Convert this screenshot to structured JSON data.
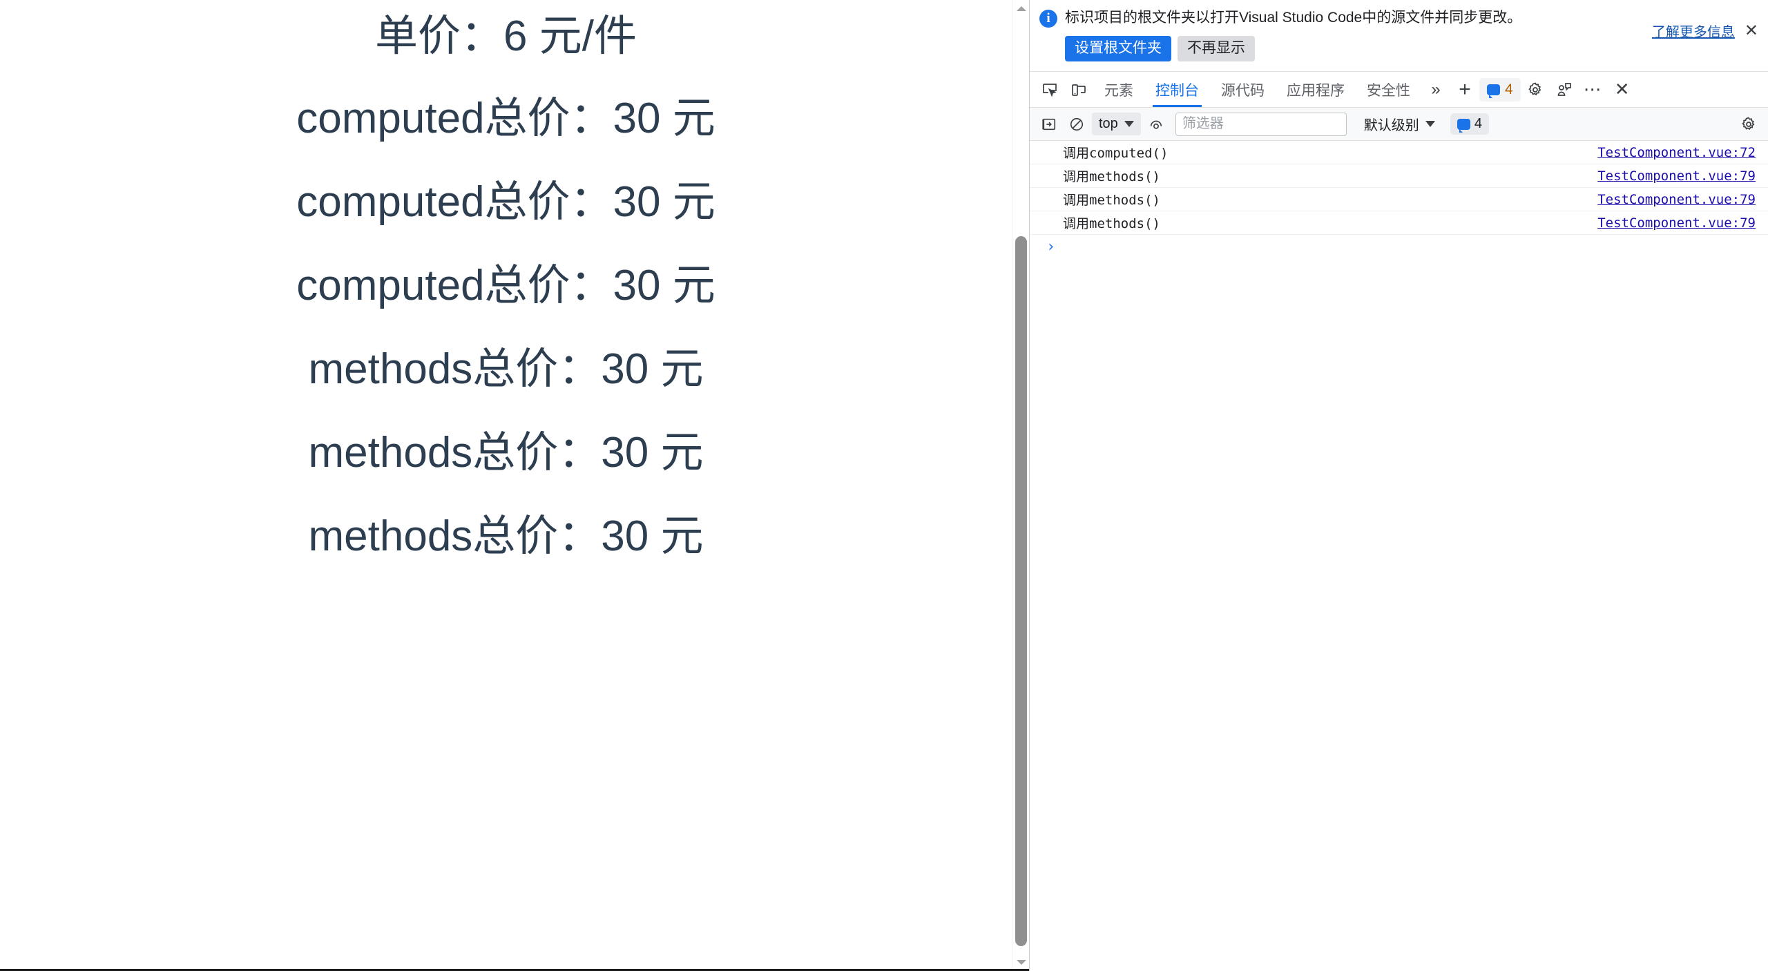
{
  "page": {
    "lines": [
      "单价：6 元/件",
      "computed总价：30 元",
      "computed总价：30 元",
      "computed总价：30 元",
      "methods总价：30 元",
      "methods总价：30 元",
      "methods总价：30 元"
    ],
    "text_color": "#2c3e50"
  },
  "infobar": {
    "icon": "info-icon",
    "message": "标识项目的根文件夹以打开Visual Studio Code中的源文件并同步更改。",
    "primary_button": "设置根文件夹",
    "secondary_button": "不再显示",
    "link": "了解更多信息",
    "close": "✕",
    "accent_color": "#1a73e8"
  },
  "devtools": {
    "tabs": [
      {
        "label": "元素",
        "active": false
      },
      {
        "label": "控制台",
        "active": true
      },
      {
        "label": "源代码",
        "active": false
      },
      {
        "label": "应用程序",
        "active": false
      },
      {
        "label": "安全性",
        "active": false
      }
    ],
    "more_tabs_label": "»",
    "add_tab_label": "+",
    "message_count": "4",
    "more_options_label": "⋯",
    "close_label": "✕",
    "accent_color": "#1a73e8",
    "badge_count_color": "#b06000"
  },
  "console": {
    "context": "top",
    "filter_placeholder": "筛选器",
    "level": "默认级别",
    "badge_count": "4",
    "prompt": "›",
    "messages": [
      {
        "text": "调用computed()",
        "source": "TestComponent.vue:72"
      },
      {
        "text": "调用methods()",
        "source": "TestComponent.vue:79"
      },
      {
        "text": "调用methods()",
        "source": "TestComponent.vue:79"
      },
      {
        "text": "调用methods()",
        "source": "TestComponent.vue:79"
      }
    ],
    "link_color": "#1a0dab"
  }
}
